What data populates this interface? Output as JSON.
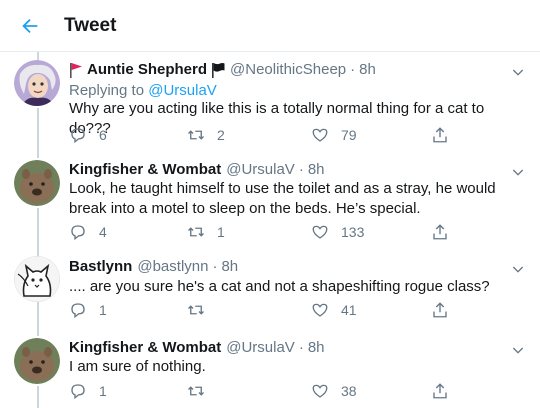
{
  "header": {
    "title": "Tweet"
  },
  "tweets": [
    {
      "name": "Auntie Shepherd",
      "handle": "@NeolithicSheep",
      "separator": "·",
      "time": "8h",
      "reply_prefix": "Replying to",
      "reply_mention": "@UrsulaV",
      "text": "Why are you acting like this is a totally normal thing for a cat to do???",
      "replies": "6",
      "retweets": "2",
      "likes": "79"
    },
    {
      "name": "Kingfisher & Wombat",
      "handle": "@UrsulaV",
      "separator": "·",
      "time": "8h",
      "text": "Look, he taught himself to use the toilet and as a stray, he would break into a motel to sleep on the beds. He’s special.",
      "replies": "4",
      "retweets": "1",
      "likes": "133"
    },
    {
      "name": "Bastlynn",
      "handle": "@bastlynn",
      "separator": "·",
      "time": "8h",
      "text": ".... are you sure he's a cat and not a shapeshifting rogue class?",
      "replies": "1",
      "retweets": "",
      "likes": "41"
    },
    {
      "name": "Kingfisher & Wombat",
      "handle": "@UrsulaV",
      "separator": "·",
      "time": "8h",
      "text": "I am sure of nothing.",
      "replies": "1",
      "retweets": "",
      "likes": "38"
    }
  ],
  "icons": {
    "back": "arrow-left-icon",
    "more": "chevron-down-icon",
    "reply": "reply-icon",
    "retweet": "retweet-icon",
    "like": "heart-icon",
    "share": "share-icon"
  },
  "colors": {
    "accent": "#1da1f2",
    "secondary_text": "#657786",
    "flag_red": "#e0245e",
    "flag_black": "#14171a",
    "thread_line": "#ccd6dd"
  }
}
